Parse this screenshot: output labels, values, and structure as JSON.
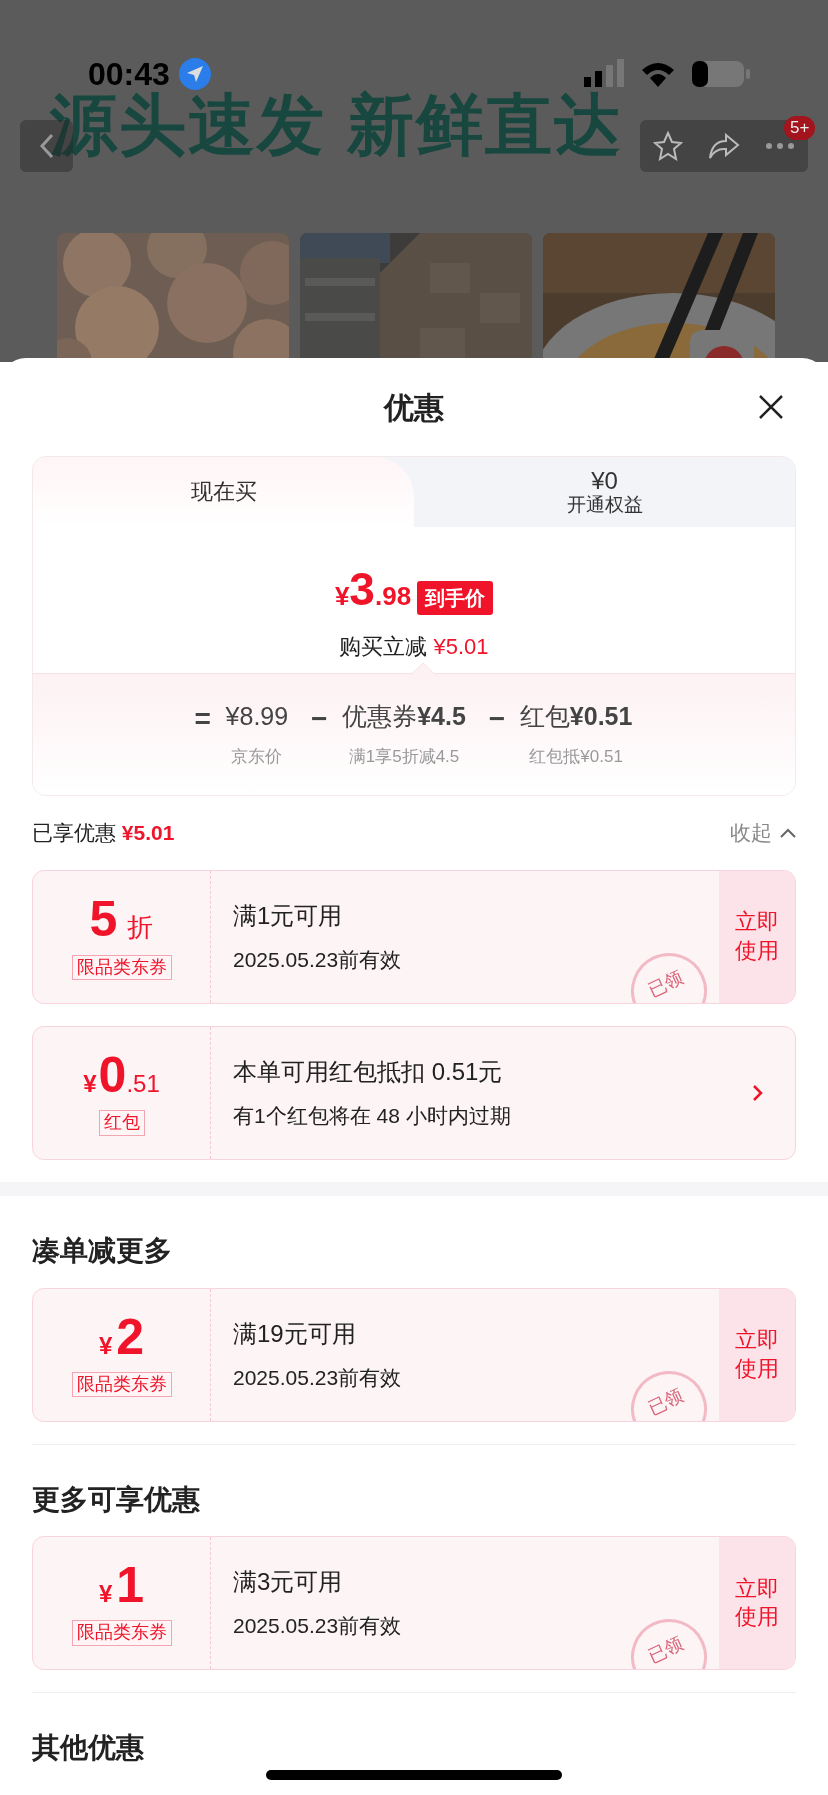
{
  "status_bar": {
    "time": "00:43"
  },
  "banner": {
    "headline": "源头速发 新鲜直达",
    "badge": "5+"
  },
  "sheet": {
    "title": "优惠",
    "tabs": [
      {
        "label": "现在买",
        "selected": true
      },
      {
        "amount": "¥0",
        "label": "开通权益",
        "selected": false
      }
    ],
    "price": {
      "currency": "¥",
      "integer": "3",
      "decimal": ".98",
      "badge": "到手价",
      "saving_label": "购买立减",
      "saving": "¥5.01"
    },
    "breakdown": [
      {
        "operator": "=",
        "value": "¥8.99",
        "note": "京东价"
      },
      {
        "operator": "−",
        "value": "优惠券**¥4.5**",
        "note": "满1享5折减4.5"
      },
      {
        "operator": "−",
        "value": "红包**¥0.51**",
        "note": "红包抵¥0.51"
      }
    ],
    "applied": {
      "label": "已享优惠",
      "amount": "¥5.01",
      "toggle": "收起",
      "expanded": true
    },
    "coupons": [
      {
        "kind": "discount",
        "main": "5",
        "suffix": "折",
        "tag": "限品类东券",
        "title": "满1元可用",
        "subtitle": "2025.05.23前有效",
        "action": "立即使用",
        "stamp": "已领"
      },
      {
        "kind": "redpacket",
        "prefix": "¥",
        "main": "0",
        "suffix": ".51",
        "tag": "红包",
        "title": "本单可用红包抵扣 0.51元",
        "subtitle": "有1个红包将在 48 小时内过期"
      }
    ],
    "sections": [
      {
        "heading": "凑单减更多",
        "coupons": [
          {
            "kind": "cash",
            "prefix": "¥",
            "main": "2",
            "tag": "限品类东券",
            "title": "满19元可用",
            "subtitle": "2025.05.23前有效",
            "action": "立即使用",
            "stamp": "已领"
          }
        ]
      },
      {
        "heading": "更多可享优惠",
        "coupons": [
          {
            "kind": "cash",
            "prefix": "¥",
            "main": "1",
            "tag": "限品类东券",
            "title": "满3元可用",
            "subtitle": "2025.05.23前有效",
            "action": "立即使用",
            "stamp": "已领"
          }
        ]
      },
      {
        "heading": "其他优惠"
      }
    ]
  }
}
